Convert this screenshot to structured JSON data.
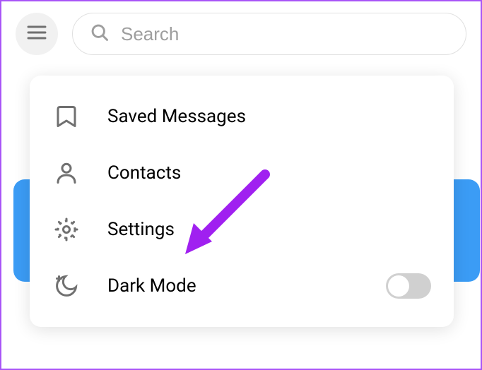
{
  "search": {
    "placeholder": "Search"
  },
  "menu": {
    "items": [
      {
        "label": "Saved Messages"
      },
      {
        "label": "Contacts"
      },
      {
        "label": "Settings"
      },
      {
        "label": "Dark Mode"
      }
    ]
  },
  "dark_mode": {
    "enabled": false
  },
  "annotation": {
    "color": "#a020f0",
    "target": "settings"
  }
}
